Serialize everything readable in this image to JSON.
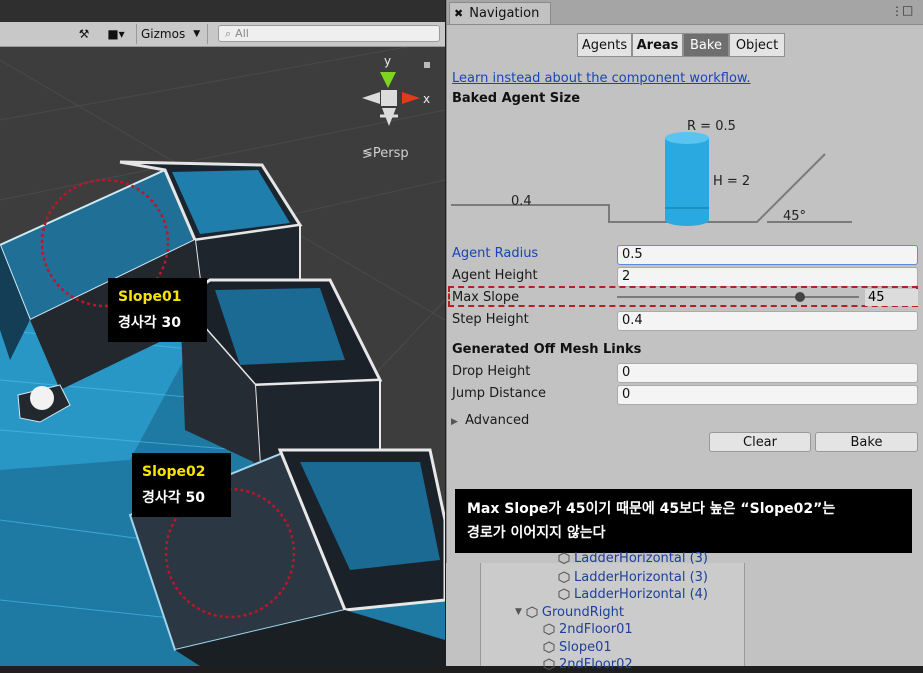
{
  "scene": {
    "toolbar": {
      "gizmos_label": "Gizmos",
      "search_placeholder": "All"
    },
    "gizmo": {
      "y_label": "y",
      "x_label": "x",
      "persp_label": "≶Persp"
    },
    "labels": [
      {
        "title": "Slope01",
        "subtitle": "경사각 30"
      },
      {
        "title": "Slope02",
        "subtitle": "경사각 50"
      }
    ]
  },
  "navigation": {
    "window_title": "Navigation",
    "tabs": [
      {
        "label": "Agents",
        "active": false
      },
      {
        "label": "Areas",
        "active": false
      },
      {
        "label": "Bake",
        "active": true
      },
      {
        "label": "Object",
        "active": false
      }
    ],
    "link": "Learn instead about the component workflow.",
    "baked_agent_size_title": "Baked Agent Size",
    "diagram": {
      "radius_label": "R = 0.5",
      "height_label": "H = 2",
      "step_label": "0.4",
      "slope_label": "45°"
    },
    "fields": {
      "agent_radius": {
        "label": "Agent Radius",
        "value": "0.5"
      },
      "agent_height": {
        "label": "Agent Height",
        "value": "2"
      },
      "max_slope": {
        "label": "Max Slope",
        "value": "45",
        "slider_fraction": 0.5
      },
      "step_height": {
        "label": "Step Height",
        "value": "0.4"
      }
    },
    "offmesh_title": "Generated Off Mesh Links",
    "offmesh": {
      "drop_height": {
        "label": "Drop Height",
        "value": "0"
      },
      "jump_distance": {
        "label": "Jump Distance",
        "value": "0"
      }
    },
    "advanced_label": "Advanced",
    "clear_label": "Clear",
    "bake_label": "Bake"
  },
  "callout": {
    "line1": "Max Slope가 45이기 때문에 45보다 높은 “Slope02”는",
    "line2": "경로가 이어지지 않는다"
  },
  "hierarchy": {
    "items": [
      {
        "label": "LadderHorizontal (3)",
        "depth": 2
      },
      {
        "label": "LadderHorizontal (3)",
        "depth": 2
      },
      {
        "label": "LadderHorizontal (4)",
        "depth": 2
      },
      {
        "label": "GroundRight",
        "depth": 1,
        "expanded": true
      },
      {
        "label": "2ndFloor01",
        "depth": 2
      },
      {
        "label": "Slope01",
        "depth": 2
      },
      {
        "label": "2ndFloor02",
        "depth": 2
      }
    ]
  },
  "colors": {
    "accent_highlight": "#b22222",
    "label_yellow": "#f7e400",
    "link_blue": "#1a44b8",
    "cylinder_blue": "#29a9e0"
  }
}
